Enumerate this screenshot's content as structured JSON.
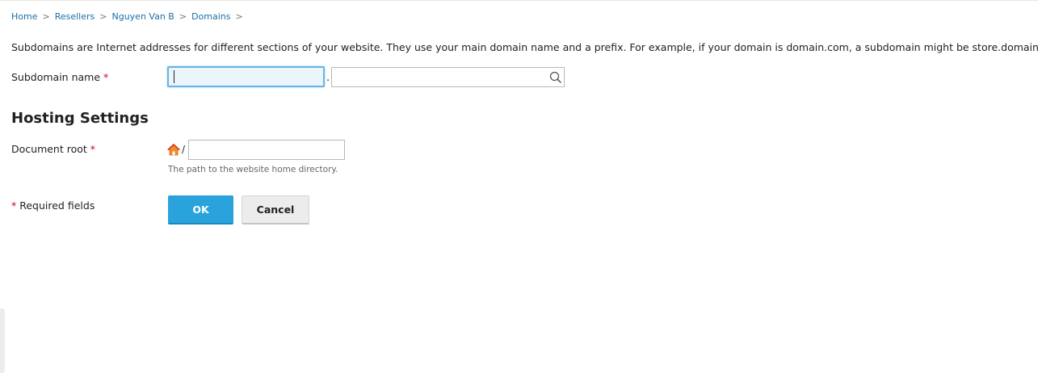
{
  "breadcrumb": {
    "items": [
      "Home",
      "Resellers",
      "Nguyen Van B",
      "Domains"
    ],
    "separator": ">"
  },
  "description": "Subdomains are Internet addresses for different sections of your website. They use your main domain name and a prefix. For example, if your domain is domain.com, a subdomain might be store.domain.com.",
  "form": {
    "subdomain_label": "Subdomain name",
    "required_mark": "*",
    "subdomain_value": "",
    "dot": ".",
    "domain_value": "",
    "hosting_title": "Hosting Settings",
    "docroot_label": "Document root",
    "docroot_prefix": "/",
    "docroot_value": "",
    "docroot_hint": "The path to the website home directory.",
    "required_fields_label": "Required fields"
  },
  "buttons": {
    "ok_label": "OK",
    "cancel_label": "Cancel"
  },
  "icons": {
    "search": "search-icon",
    "home": "home-icon"
  },
  "colors": {
    "link": "#1a6ea8",
    "required": "#d0021b",
    "primary_button": "#2aa3dd",
    "focus_border": "#6cb3e3"
  }
}
